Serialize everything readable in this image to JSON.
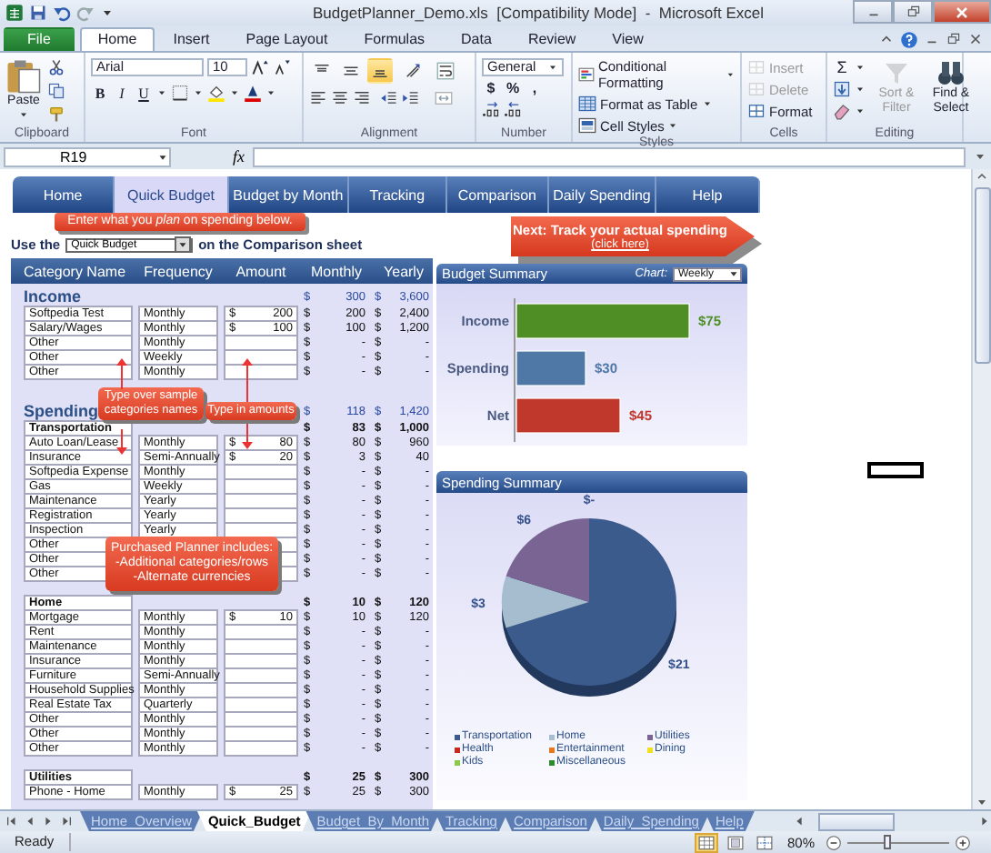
{
  "window": {
    "title": "BudgetPlanner_Demo.xls  [Compatibility Mode]  -  Microsoft Excel"
  },
  "ribbon_tabs": [
    {
      "label": "File",
      "kind": "file",
      "selected": false
    },
    {
      "label": "Home",
      "kind": "tab",
      "selected": true
    },
    {
      "label": "Insert",
      "kind": "tab",
      "selected": false
    },
    {
      "label": "Page Layout",
      "kind": "tab",
      "selected": false
    },
    {
      "label": "Formulas",
      "kind": "tab",
      "selected": false
    },
    {
      "label": "Data",
      "kind": "tab",
      "selected": false
    },
    {
      "label": "Review",
      "kind": "tab",
      "selected": false
    },
    {
      "label": "View",
      "kind": "tab",
      "selected": false
    }
  ],
  "ribbon": {
    "paste": "Paste",
    "font_name": "Arial",
    "font_size": "10",
    "font_styles": [
      "B",
      "I",
      "U"
    ],
    "vertical_align": [
      {
        "selected": false
      },
      {
        "selected": false
      },
      {
        "selected": true
      }
    ],
    "number_format": "General",
    "number_buttons": [
      "$",
      "%",
      ","
    ],
    "styles": [
      "Conditional Formatting",
      "Format as Table",
      "Cell Styles"
    ],
    "cells": [
      {
        "label": "Insert",
        "disabled": true
      },
      {
        "label": "Delete",
        "disabled": true
      },
      {
        "label": "Format",
        "disabled": false
      }
    ],
    "autosum": "Σ",
    "editing": [
      {
        "label": "Sort & Filter",
        "disabled": true
      },
      {
        "label": "Find & Select",
        "disabled": false
      }
    ],
    "groups": [
      "Clipboard",
      "Font",
      "Alignment",
      "Number",
      "Styles",
      "Cells",
      "Editing"
    ]
  },
  "formula_bar": {
    "name_box": "R19",
    "fx": "fx"
  },
  "nav": [
    {
      "label": "Home",
      "selected": false
    },
    {
      "label": "Quick Budget",
      "selected": true
    },
    {
      "label": "Budget by Month",
      "selected": false
    },
    {
      "label": "Tracking",
      "selected": false
    },
    {
      "label": "Comparison",
      "selected": false
    },
    {
      "label": "Daily Spending",
      "selected": false
    },
    {
      "label": "Help",
      "selected": false
    }
  ],
  "hint": "Enter what you *plan* on spending below.",
  "next_button": {
    "label": "Next: Track your actual spending",
    "link": "(click here)"
  },
  "use_sheet": {
    "before": "Use the",
    "value": "Quick Budget",
    "after": "on the Comparison sheet"
  },
  "table": {
    "columns": [
      "Category Name",
      "Frequency",
      "Amount",
      "Monthly",
      "Yearly"
    ],
    "sections": [
      {
        "title": "Income",
        "monthly": [
          "$",
          "300"
        ],
        "yearly": [
          "$",
          "3,600"
        ],
        "groups": [
          {
            "rows": [
              {
                "category": "Softpedia Test",
                "frequency": "Monthly",
                "amount": [
                  "$",
                  "200"
                ],
                "monthly": [
                  "$",
                  "200"
                ],
                "yearly": [
                  "$",
                  "2,400"
                ]
              },
              {
                "category": "Salary/Wages",
                "frequency": "Monthly",
                "amount": [
                  "$",
                  "100"
                ],
                "monthly": [
                  "$",
                  "100"
                ],
                "yearly": [
                  "$",
                  "1,200"
                ]
              },
              {
                "category": "Other",
                "frequency": "Monthly",
                "monthly": [
                  "$",
                  "-"
                ],
                "yearly": [
                  "$",
                  "-"
                ]
              },
              {
                "category": "Other",
                "frequency": "Weekly",
                "monthly": [
                  "$",
                  "-"
                ],
                "yearly": [
                  "$",
                  "-"
                ]
              },
              {
                "category": "Other",
                "frequency": "Monthly",
                "monthly": [
                  "$",
                  "-"
                ],
                "yearly": [
                  "$",
                  "-"
                ]
              }
            ]
          }
        ]
      },
      {
        "title": "Spending",
        "monthly": [
          "$",
          "118"
        ],
        "yearly": [
          "$",
          "1,420"
        ],
        "groups": [
          {
            "title": "Transportation",
            "monthly": [
              "$",
              "83"
            ],
            "yearly": [
              "$",
              "1,000"
            ],
            "rows": [
              {
                "category": "Auto Loan/Lease",
                "frequency": "Monthly",
                "amount": [
                  "$",
                  "80"
                ],
                "monthly": [
                  "$",
                  "80"
                ],
                "yearly": [
                  "$",
                  "960"
                ]
              },
              {
                "category": "Insurance",
                "frequency": "Semi-Annually",
                "amount": [
                  "$",
                  "20"
                ],
                "monthly": [
                  "$",
                  "3"
                ],
                "yearly": [
                  "$",
                  "40"
                ]
              },
              {
                "category": "Softpedia Expense",
                "frequency": "Monthly",
                "monthly": [
                  "$",
                  "-"
                ],
                "yearly": [
                  "$",
                  "-"
                ]
              },
              {
                "category": "Gas",
                "frequency": "Weekly",
                "monthly": [
                  "$",
                  "-"
                ],
                "yearly": [
                  "$",
                  "-"
                ]
              },
              {
                "category": "Maintenance",
                "frequency": "Yearly",
                "monthly": [
                  "$",
                  "-"
                ],
                "yearly": [
                  "$",
                  "-"
                ]
              },
              {
                "category": "Registration",
                "frequency": "Yearly",
                "monthly": [
                  "$",
                  "-"
                ],
                "yearly": [
                  "$",
                  "-"
                ]
              },
              {
                "category": "Inspection",
                "frequency": "Yearly",
                "monthly": [
                  "$",
                  "-"
                ],
                "yearly": [
                  "$",
                  "-"
                ]
              },
              {
                "category": "Other",
                "monthly": [
                  "$",
                  "-"
                ],
                "yearly": [
                  "$",
                  "-"
                ]
              },
              {
                "category": "Other",
                "monthly": [
                  "$",
                  "-"
                ],
                "yearly": [
                  "$",
                  "-"
                ]
              },
              {
                "category": "Other",
                "monthly": [
                  "$",
                  "-"
                ],
                "yearly": [
                  "$",
                  "-"
                ]
              }
            ]
          },
          {
            "title": "Home",
            "monthly": [
              "$",
              "10"
            ],
            "yearly": [
              "$",
              "120"
            ],
            "rows": [
              {
                "category": "Mortgage",
                "frequency": "Monthly",
                "amount": [
                  "$",
                  "10"
                ],
                "monthly": [
                  "$",
                  "10"
                ],
                "yearly": [
                  "$",
                  "120"
                ]
              },
              {
                "category": "Rent",
                "frequency": "Monthly",
                "monthly": [
                  "$",
                  "-"
                ],
                "yearly": [
                  "$",
                  "-"
                ]
              },
              {
                "category": "Maintenance",
                "frequency": "Monthly",
                "monthly": [
                  "$",
                  "-"
                ],
                "yearly": [
                  "$",
                  "-"
                ]
              },
              {
                "category": "Insurance",
                "frequency": "Monthly",
                "monthly": [
                  "$",
                  "-"
                ],
                "yearly": [
                  "$",
                  "-"
                ]
              },
              {
                "category": "Furniture",
                "frequency": "Semi-Annually",
                "monthly": [
                  "$",
                  "-"
                ],
                "yearly": [
                  "$",
                  "-"
                ]
              },
              {
                "category": "Household Supplies",
                "frequency": "Monthly",
                "monthly": [
                  "$",
                  "-"
                ],
                "yearly": [
                  "$",
                  "-"
                ]
              },
              {
                "category": "Real Estate Tax",
                "frequency": "Quarterly",
                "monthly": [
                  "$",
                  "-"
                ],
                "yearly": [
                  "$",
                  "-"
                ]
              },
              {
                "category": "Other",
                "frequency": "Monthly",
                "monthly": [
                  "$",
                  "-"
                ],
                "yearly": [
                  "$",
                  "-"
                ]
              },
              {
                "category": "Other",
                "frequency": "Monthly",
                "monthly": [
                  "$",
                  "-"
                ],
                "yearly": [
                  "$",
                  "-"
                ]
              },
              {
                "category": "Other",
                "frequency": "Monthly",
                "monthly": [
                  "$",
                  "-"
                ],
                "yearly": [
                  "$",
                  "-"
                ]
              }
            ]
          },
          {
            "title": "Utilities",
            "monthly": [
              "$",
              "25"
            ],
            "yearly": [
              "$",
              "300"
            ],
            "rows": [
              {
                "category": "Phone - Home",
                "frequency": "Monthly",
                "amount": [
                  "$",
                  "25"
                ],
                "monthly": [
                  "$",
                  "25"
                ],
                "yearly": [
                  "$",
                  "300"
                ]
              }
            ]
          }
        ]
      }
    ]
  },
  "callouts": [
    {
      "lines": [
        "Type over sample",
        "categories names"
      ]
    },
    {
      "lines": [
        "Type in amounts"
      ]
    },
    {
      "lines": [
        "Purchased Planner  includes:",
        "-Additional categories/rows",
        "-Alternate currencies"
      ]
    }
  ],
  "budget_summary": {
    "title": "Budget Summary",
    "chart_label": "Chart:",
    "period": "Weekly",
    "chart_data": {
      "type": "bar",
      "orientation": "horizontal",
      "categories": [
        "Income",
        "Spending",
        "Net"
      ],
      "values": [
        75,
        30,
        45
      ],
      "colors": [
        "#4e8e24",
        "#4f78a6",
        "#c0382b"
      ],
      "value_labels": [
        "$75",
        "$30",
        "$45"
      ]
    }
  },
  "spending_summary": {
    "title": "Spending Summary",
    "chart_data": {
      "type": "pie",
      "categories": [
        "Transportation",
        "Home",
        "Utilities",
        "Health",
        "Entertainment",
        "Dining",
        "Kids",
        "Miscellaneous"
      ],
      "values": [
        21,
        3,
        6,
        0,
        0,
        0,
        0,
        0
      ],
      "colors": [
        "#3b5b8c",
        "#a6bccf",
        "#7a6494",
        "#c8281e",
        "#e8781e",
        "#f0e020",
        "#8cc84a",
        "#2e8a2e"
      ],
      "value_labels": [
        "$21",
        "$3",
        "$6",
        "$-",
        null,
        null,
        null,
        null
      ],
      "legend": "bottom"
    }
  },
  "sheet_tabs": [
    {
      "label": "Home_Overview",
      "selected": false
    },
    {
      "label": "Quick_Budget",
      "selected": true
    },
    {
      "label": "Budget_By_Month",
      "selected": false
    },
    {
      "label": "Tracking",
      "selected": false
    },
    {
      "label": "Comparison",
      "selected": false
    },
    {
      "label": "Daily_Spending",
      "selected": false
    },
    {
      "label": "Help",
      "selected": false
    }
  ],
  "status_bar": {
    "text": "Ready",
    "views": [
      {
        "selected": true
      },
      {
        "selected": false
      },
      {
        "selected": false
      }
    ],
    "zoom": {
      "label": "80%",
      "level": 0.4
    }
  }
}
